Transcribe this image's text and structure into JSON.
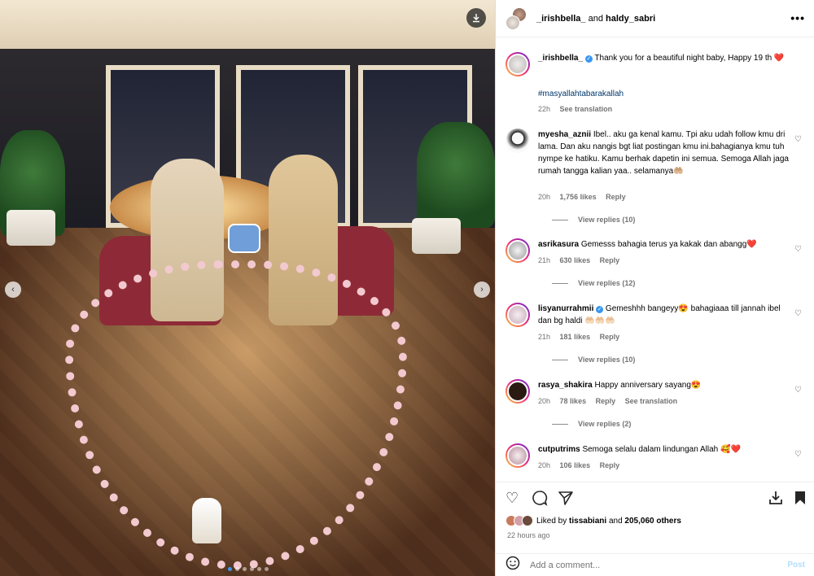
{
  "header": {
    "user1": "_irishbella_",
    "joiner": "and",
    "user2": "haldy_sabri",
    "more_label": "•••"
  },
  "caption": {
    "username": "_irishbella_",
    "text": "Thank you for a beautiful night baby, Happy 19 th ❤️",
    "hashtag": "#masyallahtabarakallah",
    "time": "22h",
    "see_translation": "See translation"
  },
  "comments": [
    {
      "username": "myesha_aznii",
      "text": "Ibel.. aku ga kenal kamu. Tpi aku udah follow kmu dri lama. Dan aku nangis bgt liat postingan kmu ini.bahagianya kmu tuh nympe ke hatiku. Kamu berhak dapetin ini semua. Semoga Allah jaga rumah tangga kalian yaa.. selamanya🤲🏼",
      "time": "20h",
      "likes": "1,756 likes",
      "reply": "Reply",
      "view_replies": "View replies (10)"
    },
    {
      "username": "asrikasura",
      "text": "Gemesss bahagia terus ya kakak dan abangg❤️",
      "time": "21h",
      "likes": "630 likes",
      "reply": "Reply",
      "view_replies": "View replies (12)"
    },
    {
      "username": "lisyanurrahmii",
      "text": "Gemeshhh bangeyy😍 bahagiaaa till jannah ibel dan bg haldi 🤲🏻🤲🏻🤲🏻",
      "time": "21h",
      "likes": "181 likes",
      "reply": "Reply",
      "view_replies": "View replies (10)"
    },
    {
      "username": "rasya_shakira",
      "text": "Happy anniversary sayang😍",
      "time": "20h",
      "likes": "78 likes",
      "reply": "Reply",
      "see_translation": "See translation",
      "view_replies": "View replies (2)"
    },
    {
      "username": "cutputrims",
      "text": "Semoga selalu dalam lindungan Allah 🥰❤️",
      "time": "20h",
      "likes": "106 likes",
      "reply": "Reply"
    }
  ],
  "likes": {
    "prefix": "Liked by",
    "user": "tissabiani",
    "joiner": "and",
    "count": "205,060 others"
  },
  "posted_ago": "22 hours ago",
  "comment_input": {
    "placeholder": "Add a comment...",
    "post_label": "Post"
  },
  "icons": {
    "download": "⤓",
    "prev": "‹",
    "next": "›",
    "heart": "♡",
    "comment": "◯",
    "share": "➢",
    "save": "▮",
    "emoji": "☺"
  },
  "colors": {
    "accent": "#0095f6",
    "verified": "#3897f0",
    "post_disabled": "#b2dffc"
  },
  "carousel": {
    "slides": 6,
    "active": 0
  }
}
